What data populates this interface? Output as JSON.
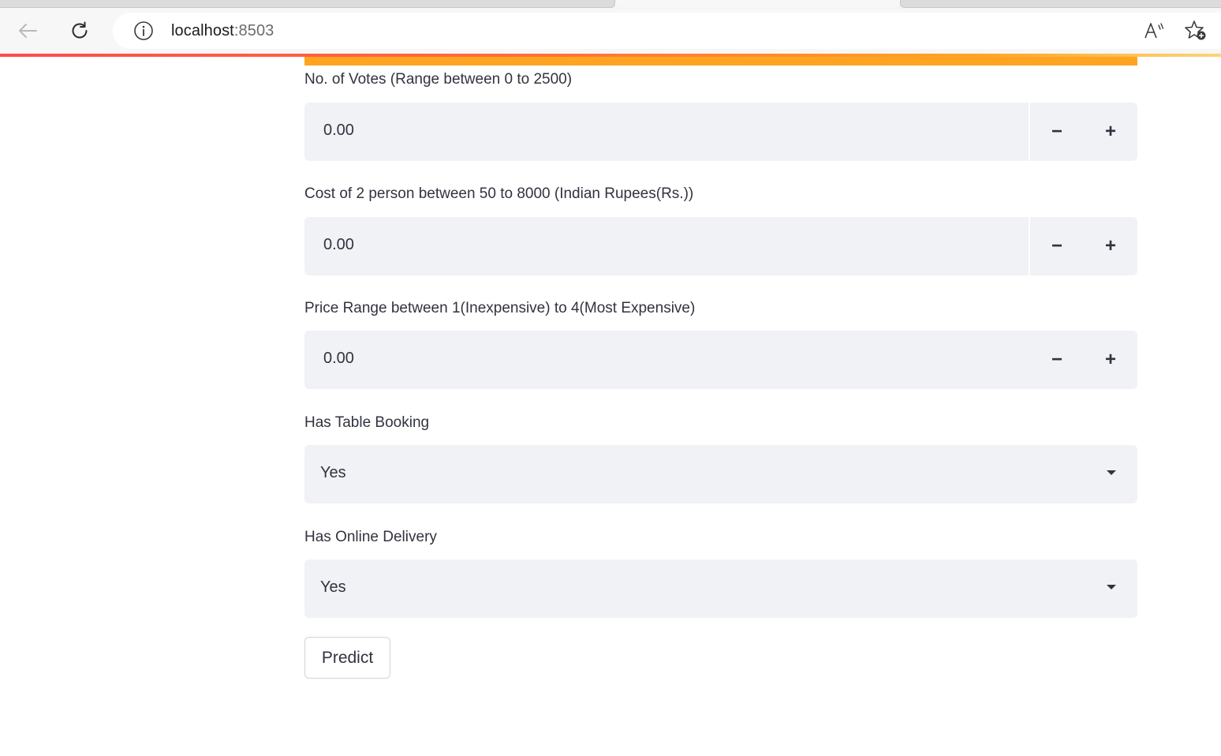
{
  "browser": {
    "url_host": "localhost",
    "url_port": ":8503"
  },
  "form": {
    "votes": {
      "label": "No. of Votes (Range between 0 to 2500)",
      "value": "0.00",
      "minus": "−",
      "plus": "+"
    },
    "cost": {
      "label": "Cost of 2 person between 50 to 8000 (Indian Rupees(Rs.))",
      "value": "0.00",
      "minus": "−",
      "plus": "+"
    },
    "price_range": {
      "label": "Price Range between 1(Inexpensive) to 4(Most Expensive)",
      "value": "0.00",
      "minus": "−",
      "plus": "+"
    },
    "table_booking": {
      "label": "Has Table Booking",
      "value": "Yes"
    },
    "online_delivery": {
      "label": "Has Online Delivery",
      "value": "Yes"
    },
    "predict_label": "Predict"
  },
  "colors": {
    "accent": "#ff4b4b",
    "progress": "#ffa421",
    "input_bg": "#f0f2f6",
    "text": "#31333f"
  },
  "icons": [
    "back-arrow-icon",
    "reload-icon",
    "info-icon",
    "read-aloud-icon",
    "favorite-add-icon",
    "chevron-down-icon"
  ]
}
